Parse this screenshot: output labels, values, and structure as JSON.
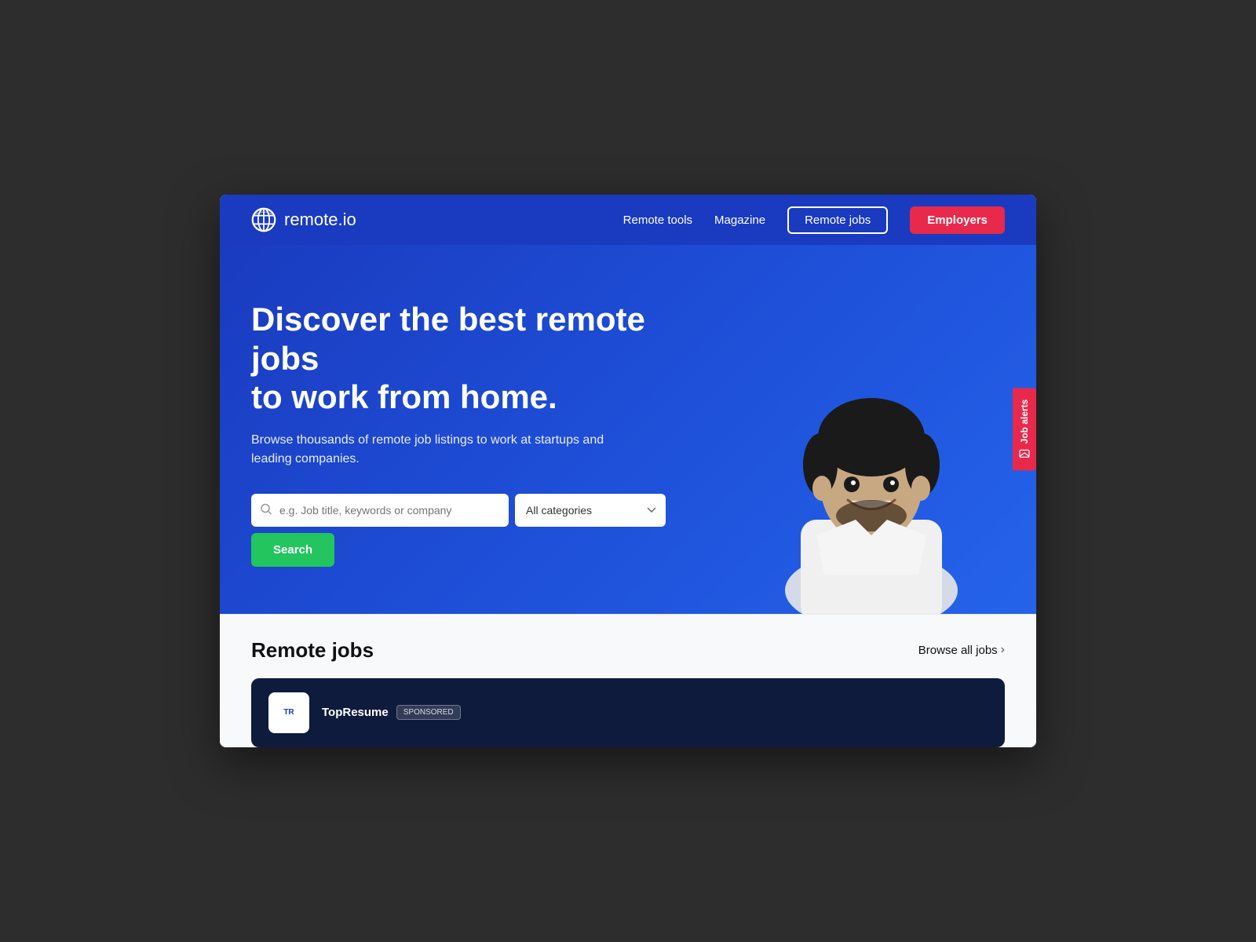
{
  "meta": {
    "title": "remote.io - Discover the best remote jobs"
  },
  "navbar": {
    "logo_text": "remote",
    "logo_suffix": ".io",
    "nav_items": [
      {
        "label": "Remote tools",
        "id": "remote-tools"
      },
      {
        "label": "Magazine",
        "id": "magazine"
      }
    ],
    "remote_jobs_btn": "Remote jobs",
    "employers_btn": "Employers"
  },
  "hero": {
    "title": "Discover the best remote jobs\nto work from home.",
    "subtitle": "Browse thousands of remote job listings to work at startups\nand leading companies.",
    "search": {
      "placeholder": "e.g. Job title, keywords or company",
      "category_default": "All categories",
      "search_btn": "Search"
    },
    "job_alerts_label": "Job alerts"
  },
  "jobs_section": {
    "title": "Remote jobs",
    "browse_all": "Browse all jobs",
    "sponsored_company": "TopResume",
    "sponsored_label": "SPONSORED"
  }
}
